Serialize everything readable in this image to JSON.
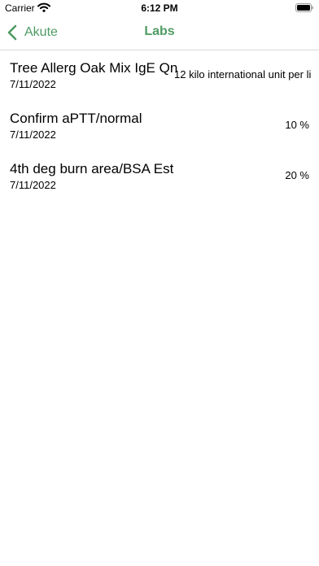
{
  "status_bar": {
    "carrier": "Carrier",
    "time": "6:12 PM",
    "wifi_icon": "wifi-icon",
    "battery_icon": "battery-icon"
  },
  "nav": {
    "back_label": "Akute",
    "back_icon": "chevron-left-icon",
    "title": "Labs",
    "accent_color": "#4f9b62"
  },
  "labs": [
    {
      "name": "Tree Allerg Oak Mix IgE Qn",
      "date": "7/11/2022",
      "value": "12 kilo international unit per li"
    },
    {
      "name": "Confirm aPTT/normal",
      "date": "7/11/2022",
      "value": "10 %"
    },
    {
      "name": "4th deg burn area/BSA Est",
      "date": "7/11/2022",
      "value": "20 %"
    }
  ]
}
